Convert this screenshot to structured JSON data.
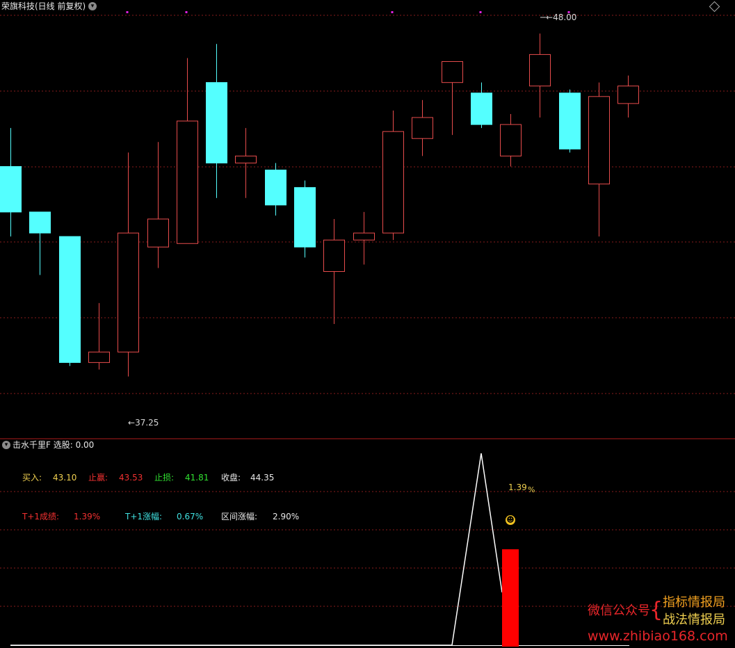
{
  "header": {
    "title": "荣旗科技(日线 前复权)",
    "collapse_icon": "chevron-down-icon",
    "settings_icon": "diamond-icon"
  },
  "price_panel": {
    "high_label": "48.00",
    "low_label": "37.25"
  },
  "chart_data": {
    "type": "candlestick",
    "y_range": [
      36.8,
      48.6
    ],
    "up_color": "#e84c4c",
    "down_color": "#54ffff",
    "candles": [
      {
        "o": 44.2,
        "h": 45.3,
        "l": 42.2,
        "c": 42.9,
        "dir": "down"
      },
      {
        "o": 42.9,
        "h": 42.9,
        "l": 41.1,
        "c": 42.3,
        "dir": "down"
      },
      {
        "o": 42.2,
        "h": 42.2,
        "l": 38.5,
        "c": 38.6,
        "dir": "down"
      },
      {
        "o": 38.6,
        "h": 40.3,
        "l": 38.4,
        "c": 38.9,
        "dir": "up"
      },
      {
        "o": 38.9,
        "h": 44.6,
        "l": 38.2,
        "c": 42.3,
        "dir": "up"
      },
      {
        "o": 41.9,
        "h": 44.9,
        "l": 41.3,
        "c": 42.7,
        "dir": "up"
      },
      {
        "o": 42.0,
        "h": 47.3,
        "l": 42.0,
        "c": 45.5,
        "dir": "up"
      },
      {
        "o": 46.6,
        "h": 47.7,
        "l": 43.3,
        "c": 44.3,
        "dir": "down"
      },
      {
        "o": 44.3,
        "h": 45.3,
        "l": 43.3,
        "c": 44.5,
        "dir": "up"
      },
      {
        "o": 44.1,
        "h": 44.3,
        "l": 42.8,
        "c": 43.1,
        "dir": "down"
      },
      {
        "o": 43.6,
        "h": 43.8,
        "l": 41.6,
        "c": 41.9,
        "dir": "down"
      },
      {
        "o": 41.2,
        "h": 42.7,
        "l": 39.7,
        "c": 42.1,
        "dir": "up"
      },
      {
        "o": 42.1,
        "h": 42.9,
        "l": 41.4,
        "c": 42.3,
        "dir": "up"
      },
      {
        "o": 42.3,
        "h": 45.8,
        "l": 42.1,
        "c": 45.2,
        "dir": "up"
      },
      {
        "o": 45.0,
        "h": 46.1,
        "l": 44.5,
        "c": 45.6,
        "dir": "up"
      },
      {
        "o": 46.6,
        "h": 46.8,
        "l": 45.1,
        "c": 47.2,
        "dir": "up"
      },
      {
        "o": 46.3,
        "h": 46.6,
        "l": 45.3,
        "c": 45.4,
        "dir": "down"
      },
      {
        "o": 44.5,
        "h": 45.7,
        "l": 44.2,
        "c": 45.4,
        "dir": "up"
      },
      {
        "o": 46.5,
        "h": 48.0,
        "l": 45.6,
        "c": 47.4,
        "dir": "up"
      },
      {
        "o": 46.3,
        "h": 46.4,
        "l": 44.6,
        "c": 44.7,
        "dir": "down"
      },
      {
        "o": 43.7,
        "h": 46.6,
        "l": 42.2,
        "c": 46.2,
        "dir": "up"
      },
      {
        "o": 46.0,
        "h": 46.8,
        "l": 45.6,
        "c": 46.5,
        "dir": "up"
      }
    ]
  },
  "indicator_panel": {
    "title": "击水千里F 选股: 0.00",
    "buy_label": "买入:",
    "buy_value": "43.10",
    "take_profit_label": "止赢:",
    "take_profit_value": "43.53",
    "stop_loss_label": "止损:",
    "stop_loss_value": "41.81",
    "close_label": "收盘:",
    "close_value": "44.35",
    "t1_result_label": "T+1成绩:",
    "t1_result_value": "1.39%",
    "t1_change_label": "T+1涨幅:",
    "t1_change_value": "0.67%",
    "range_change_label": "区间涨幅:",
    "range_change_value": "2.90%",
    "annotation_value": "1.39",
    "annotation_unit": "%",
    "smiley_icon": "smiley-icon",
    "colors": {
      "yellow": "#f0d050",
      "red": "#f03030",
      "green": "#30e030",
      "cyan": "#40e0e0",
      "white": "#e8e8e8",
      "bar_red": "#ff0000"
    }
  },
  "watermark": {
    "wechat_label": "微信公众号",
    "brace": "{",
    "name1": "指标情报局",
    "name2": "战法情报局",
    "url": "www.zhibiao168.com"
  }
}
